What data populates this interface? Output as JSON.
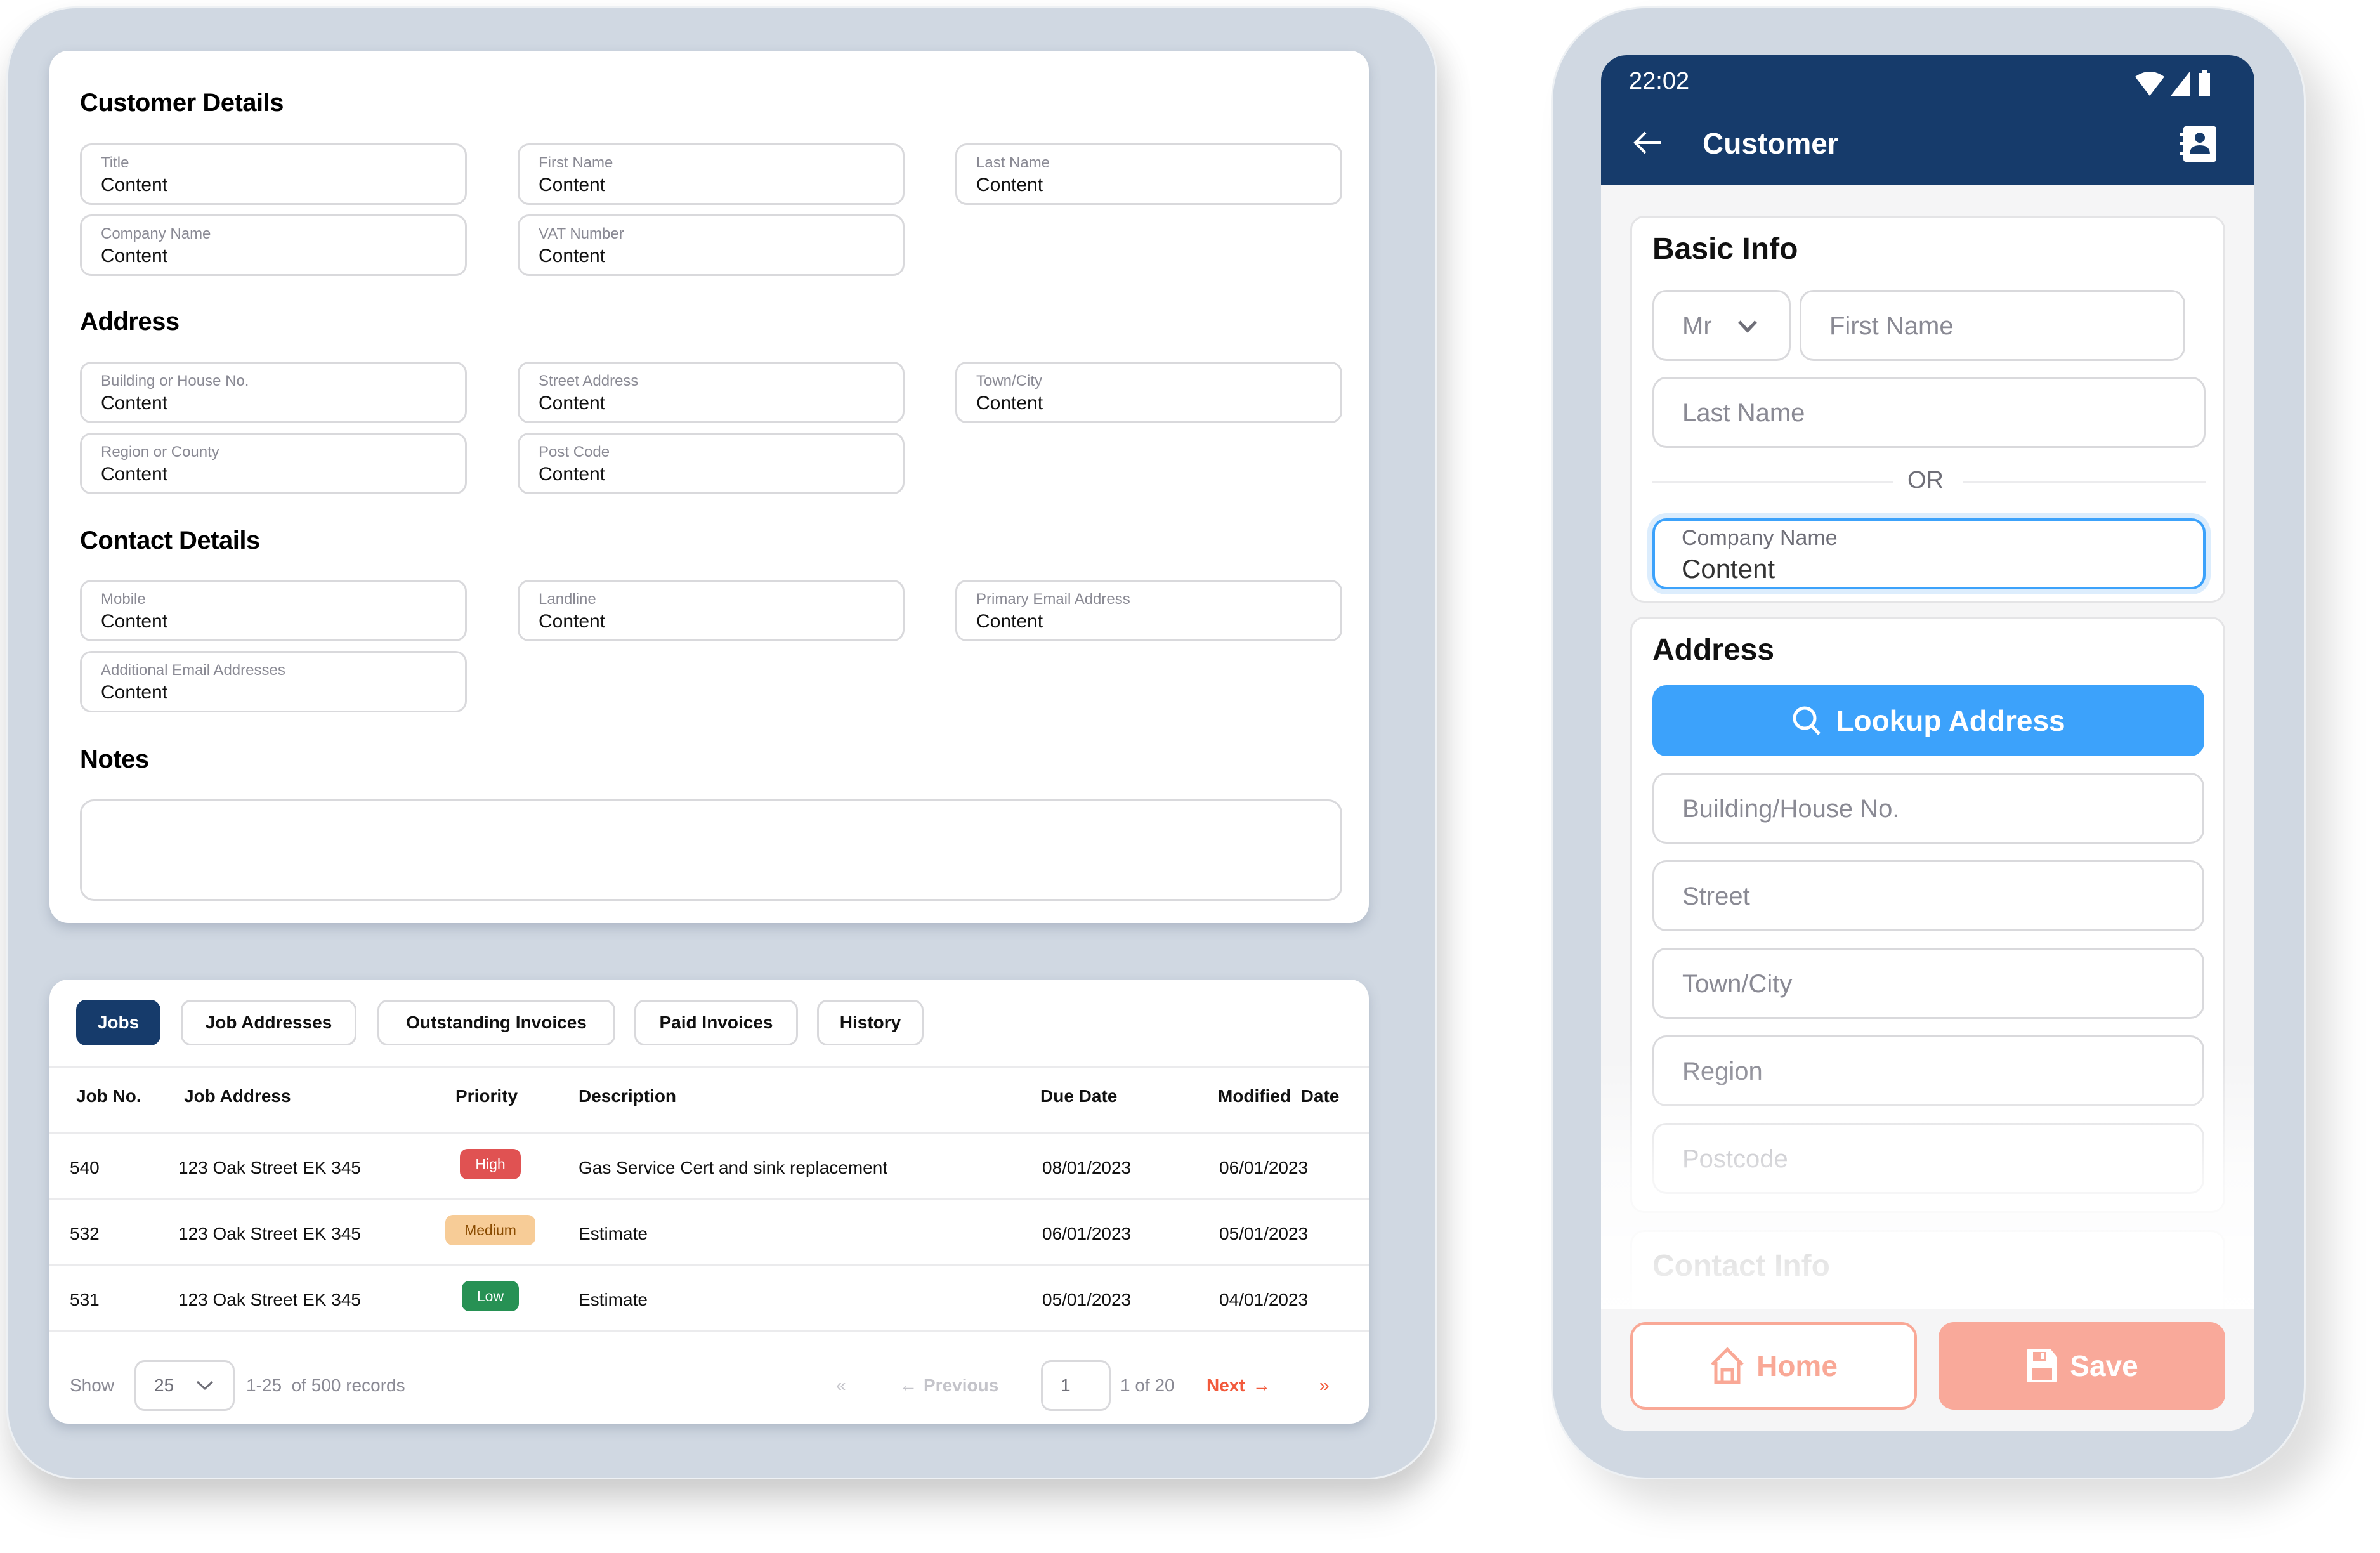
{
  "desktop": {
    "customer_details": {
      "title": "Customer Details",
      "fields": [
        {
          "label": "Title",
          "value": "Content"
        },
        {
          "label": "First Name",
          "value": "Content"
        },
        {
          "label": "Last Name",
          "value": "Content"
        },
        {
          "label": "Company Name",
          "value": "Content"
        },
        {
          "label": "VAT Number",
          "value": "Content"
        }
      ]
    },
    "address": {
      "title": "Address",
      "fields": [
        {
          "label": "Building or House No.",
          "value": "Content"
        },
        {
          "label": "Street Address",
          "value": "Content"
        },
        {
          "label": "Town/City",
          "value": "Content"
        },
        {
          "label": "Region or County",
          "value": "Content"
        },
        {
          "label": "Post Code",
          "value": "Content"
        }
      ]
    },
    "contact_details": {
      "title": "Contact Details",
      "fields": [
        {
          "label": "Mobile",
          "value": "Content"
        },
        {
          "label": "Landline",
          "value": "Content"
        },
        {
          "label": "Primary Email Address",
          "value": "Content"
        },
        {
          "label": "Additional Email Addresses",
          "value": "Content"
        }
      ]
    },
    "notes": {
      "title": "Notes",
      "value": ""
    },
    "tabs": [
      {
        "label": "Jobs",
        "active": true
      },
      {
        "label": "Job Addresses",
        "active": false
      },
      {
        "label": "Outstanding Invoices",
        "active": false
      },
      {
        "label": "Paid Invoices",
        "active": false
      },
      {
        "label": "History",
        "active": false
      }
    ],
    "table": {
      "columns": [
        "Job No.",
        "Job Address",
        "Priority",
        "Description",
        "Due Date",
        "Modified  Date"
      ],
      "rows": [
        {
          "job_no": "540",
          "address": "123 Oak Street EK 345",
          "priority": "High",
          "description": "Gas Service Cert and sink replacement",
          "due": "08/01/2023",
          "modified": "06/01/2023"
        },
        {
          "job_no": "532",
          "address": "123 Oak Street EK 345",
          "priority": "Medium",
          "description": "Estimate",
          "due": "06/01/2023",
          "modified": "05/01/2023"
        },
        {
          "job_no": "531",
          "address": "123 Oak Street EK 345",
          "priority": "Low",
          "description": "Estimate",
          "due": "05/01/2023",
          "modified": "04/01/2023"
        }
      ],
      "priority_colors": {
        "High": {
          "bg": "#e05252",
          "fg": "#ffffff"
        },
        "Medium": {
          "bg": "#f7cc97",
          "fg": "#8a4b00"
        },
        "Low": {
          "bg": "#279154",
          "fg": "#ffffff"
        }
      }
    },
    "pagination": {
      "show_label": "Show",
      "page_size": "25",
      "range_text": "1-25  of 500 records",
      "first_icon": "«",
      "previous_label": "Previous",
      "current_page": "1",
      "page_of": "1 of 20",
      "next_label": "Next",
      "last_icon": "»"
    }
  },
  "mobile": {
    "status_time": "22:02",
    "app_title": "Customer",
    "basic_info": {
      "title": "Basic Info",
      "title_select": "Mr",
      "first_name_placeholder": "First Name",
      "last_name_placeholder": "Last Name",
      "or_label": "OR",
      "company_label": "Company Name",
      "company_value": "Content"
    },
    "address": {
      "title": "Address",
      "lookup_label": "Lookup Address",
      "placeholders": [
        "Building/House No.",
        "Street",
        "Town/City",
        "Region",
        "Postcode"
      ]
    },
    "contact_info_title": "Contact Info",
    "home_label": "Home",
    "save_label": "Save"
  },
  "colors": {
    "brand_navy": "#163b6b",
    "accent_blue": "#3ca2fb",
    "next_red": "#f25a3c",
    "salmon": "#f9a896"
  }
}
